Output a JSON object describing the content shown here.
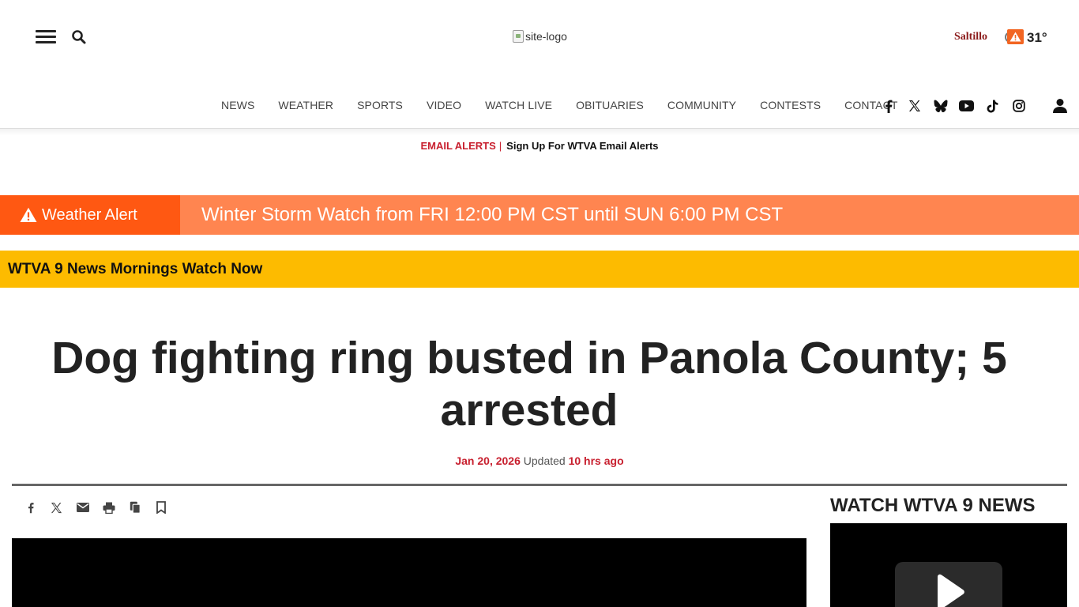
{
  "header": {
    "logo_alt": "site-logo",
    "city": "Saltillo",
    "temperature": "31°"
  },
  "nav": {
    "items": [
      "NEWS",
      "WEATHER",
      "SPORTS",
      "VIDEO",
      "WATCH LIVE",
      "OBITUARIES",
      "COMMUNITY",
      "CONTESTS",
      "CONTACT"
    ],
    "social_icons": [
      "facebook-icon",
      "x-icon",
      "bluesky-icon",
      "youtube-icon",
      "tiktok-icon",
      "instagram-icon"
    ]
  },
  "email_alerts": {
    "label": "EMAIL ALERTS",
    "separator": "|",
    "link": "Sign Up For WTVA Email Alerts"
  },
  "weather_alert": {
    "tag": "Weather Alert",
    "message": "Winter Storm Watch from FRI 12:00 PM CST until SUN 6:00 PM CST"
  },
  "banner": {
    "text": "WTVA 9 News Mornings Watch Now"
  },
  "article": {
    "headline": "Dog fighting ring busted in Panola County; 5 arrested",
    "date": "Jan 20, 2026",
    "updated_label": "Updated",
    "updated_ago": "10 hrs ago"
  },
  "share_tools": [
    "facebook-icon",
    "x-icon",
    "email-icon",
    "print-icon",
    "copy-icon",
    "bookmark-icon"
  ],
  "sidebar": {
    "title": "WATCH WTVA 9 NEWS"
  },
  "colors": {
    "brand_red": "#c8202f",
    "alert_orange": "#ff5812",
    "alert_bar": "#ff8550",
    "banner_yellow": "#fdbb00"
  }
}
